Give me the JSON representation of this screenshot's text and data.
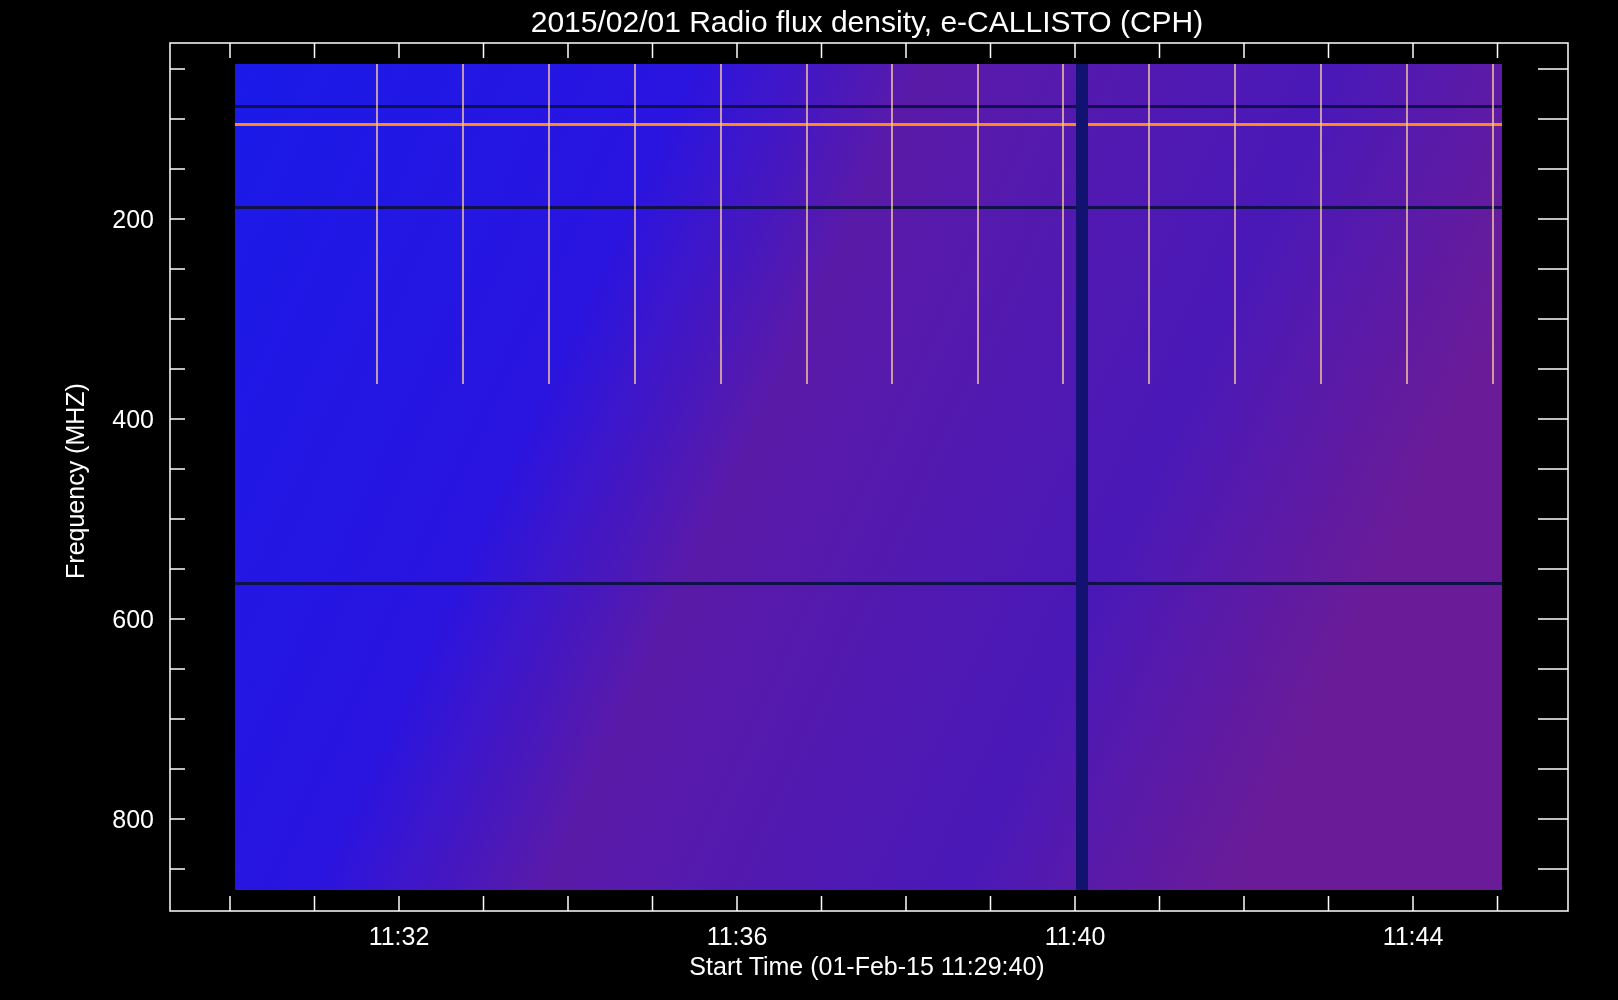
{
  "title": "2015/02/01  Radio flux density, e-CALLISTO (CPH)",
  "ylabel": "Frequency (MHZ)",
  "xlabel": "Start Time (01-Feb-15 11:29:40)",
  "yticks": [
    "200",
    "400",
    "600",
    "800"
  ],
  "xticks": [
    "11:32",
    "11:36",
    "11:40",
    "11:44"
  ]
}
